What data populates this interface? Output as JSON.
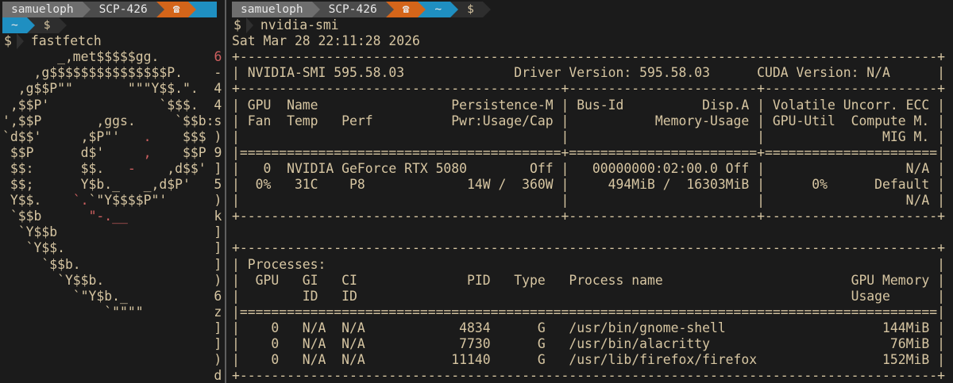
{
  "colors": {
    "background": "#1b1b1b",
    "foreground": "#d7c6a2",
    "red": "#cf6060",
    "segment_gray": "#6e6e6e",
    "segment_darkgray": "#4b4b4b",
    "segment_orange": "#d4651a",
    "segment_blue": "#1f8fc1",
    "segment_shell": "#2e2e2e",
    "prompt_fg": "#e8e8e8",
    "divider": "#5f5f5f"
  },
  "left_pane": {
    "prompt_line_1": [
      {
        "text": "samueloph",
        "bg": "segment_gray",
        "fg": "prompt_fg",
        "name": "user-segment"
      },
      {
        "text": "SCP-426",
        "bg": "segment_darkgray",
        "fg": "prompt_fg",
        "name": "host-segment"
      },
      {
        "text": "☎",
        "bg": "segment_orange",
        "fg": "prompt_fg",
        "name": "phone-icon"
      },
      {
        "text": "",
        "bg": "segment_blue",
        "fg": "prompt_fg",
        "name": "cwd-segment-clipped",
        "stub": true
      }
    ],
    "prompt_line_2": [
      {
        "text": "~",
        "bg": "segment_blue",
        "fg": "prompt_fg",
        "name": "cwd-segment"
      },
      {
        "text": "$",
        "bg": "segment_shell",
        "fg": "foreground",
        "name": "shell-segment"
      }
    ],
    "command": {
      "prompt": "$",
      "text": "fastfetch"
    },
    "fastfetch_rows": [
      [
        {
          "t": "       _,met$$$$$gg.       ",
          "c": "cream"
        },
        {
          "t": "6",
          "c": "red"
        }
      ],
      [
        {
          "t": "    ,g$$$$$$$$$$$$$$$P.    -",
          "c": "cream"
        }
      ],
      [
        {
          "t": "  ,g$$P\"\"       \"\"\"Y$$.\".  4",
          "c": "cream"
        }
      ],
      [
        {
          "t": " ,$$P'              `$$$.  4",
          "c": "cream"
        }
      ],
      [
        {
          "t": "',$$P       ,ggs.     `$$b:s",
          "c": "cream"
        }
      ],
      [
        {
          "t": "`d$$'     ,$P\"'   ",
          "c": "cream"
        },
        {
          "t": ".",
          "c": "red"
        },
        {
          "t": "    $$$ )",
          "c": "cream"
        }
      ],
      [
        {
          "t": " $$P      d$'     ",
          "c": "cream"
        },
        {
          "t": ",",
          "c": "red"
        },
        {
          "t": "    $$P 9",
          "c": "cream"
        }
      ],
      [
        {
          "t": " $$:      $$.   ",
          "c": "cream"
        },
        {
          "t": "-",
          "c": "red"
        },
        {
          "t": "    ,d$$' ]",
          "c": "cream"
        }
      ],
      [
        {
          "t": " $$;      Y$b._   _,d$P'   5",
          "c": "cream"
        }
      ],
      [
        {
          "t": " Y$$.    ",
          "c": "cream"
        },
        {
          "t": "`.",
          "c": "red"
        },
        {
          "t": "`\"Y$$$$P\"'      )",
          "c": "cream"
        }
      ],
      [
        {
          "t": " `$$b      ",
          "c": "cream"
        },
        {
          "t": "\"-.__",
          "c": "red"
        },
        {
          "t": "           k",
          "c": "cream"
        }
      ],
      [
        {
          "t": "  `Y$$b                    ]",
          "c": "cream"
        }
      ],
      [
        {
          "t": "   `Y$$.                   ]",
          "c": "cream"
        }
      ],
      [
        {
          "t": "     `$$b.                 ]",
          "c": "cream"
        }
      ],
      [
        {
          "t": "       `Y$$b.              )",
          "c": "cream"
        }
      ],
      [
        {
          "t": "         `\"Y$b._           6",
          "c": "cream"
        }
      ],
      [
        {
          "t": "             `\"\"\"\"         z",
          "c": "cream"
        }
      ],
      [
        {
          "t": "                           ]",
          "c": "cream"
        }
      ],
      [
        {
          "t": "                           ]",
          "c": "cream"
        }
      ],
      [
        {
          "t": "                           )",
          "c": "cream"
        }
      ],
      [
        {
          "t": "                           d",
          "c": "cream"
        }
      ]
    ]
  },
  "right_pane": {
    "prompt_line": [
      {
        "text": "samueloph",
        "bg": "segment_gray",
        "fg": "prompt_fg",
        "name": "user-segment"
      },
      {
        "text": "SCP-426",
        "bg": "segment_darkgray",
        "fg": "prompt_fg",
        "name": "host-segment"
      },
      {
        "text": "☎",
        "bg": "segment_orange",
        "fg": "prompt_fg",
        "name": "phone-icon"
      },
      {
        "text": "~",
        "bg": "segment_blue",
        "fg": "prompt_fg",
        "name": "cwd-segment"
      },
      {
        "text": "$",
        "bg": "segment_shell",
        "fg": "foreground",
        "name": "shell-segment"
      }
    ],
    "command": {
      "prompt": "$",
      "text": "nvidia-smi"
    },
    "date_line": "Sat Mar 28 22:11:28 2026",
    "nvidia_smi": {
      "summary": {
        "nvidia_smi_version": "595.58.03",
        "driver_version": "595.58.03",
        "cuda_version": "N/A",
        "gpus": [
          {
            "id": 0,
            "name": "NVIDIA GeForce RTX 5080",
            "persistence_m": "Off",
            "bus_id": "00000000:02:00.0",
            "disp_a": "Off",
            "volatile_uncorr_ecc": "N/A",
            "fan": "0%",
            "temp": "31C",
            "perf": "P8",
            "pwr_usage_cap": "14W /  360W",
            "memory_usage": "494MiB /  16303MiB",
            "gpu_util": "0%",
            "compute_m": "Default",
            "mig_m": "N/A"
          }
        ],
        "processes": [
          {
            "gpu": 0,
            "gi_id": "N/A",
            "ci_id": "N/A",
            "pid": 4834,
            "type": "G",
            "process_name": "/usr/bin/gnome-shell",
            "gpu_memory_usage": "144MiB"
          },
          {
            "gpu": 0,
            "gi_id": "N/A",
            "ci_id": "N/A",
            "pid": 7730,
            "type": "G",
            "process_name": "/usr/bin/alacritty",
            "gpu_memory_usage": "76MiB"
          },
          {
            "gpu": 0,
            "gi_id": "N/A",
            "ci_id": "N/A",
            "pid": 11140,
            "type": "G",
            "process_name": "/usr/lib/firefox/firefox",
            "gpu_memory_usage": "152MiB"
          }
        ]
      },
      "lines": [
        "+-----------------------------------------------------------------------------------------+",
        "| NVIDIA-SMI 595.58.03              Driver Version: 595.58.03      CUDA Version: N/A      |",
        "+-----------------------------------------+------------------------+----------------------+",
        "| GPU  Name                 Persistence-M | Bus-Id          Disp.A | Volatile Uncorr. ECC |",
        "| Fan  Temp   Perf          Pwr:Usage/Cap |           Memory-Usage | GPU-Util  Compute M. |",
        "|                                         |                        |               MIG M. |",
        "|=========================================+========================+======================|",
        "|   0  NVIDIA GeForce RTX 5080        Off |   00000000:02:00.0 Off |                  N/A |",
        "|  0%   31C    P8             14W /  360W |     494MiB /  16303MiB |      0%      Default |",
        "|                                         |                        |                  N/A |",
        "+-----------------------------------------+------------------------+----------------------+",
        "",
        "+-----------------------------------------------------------------------------------------+",
        "| Processes:                                                                              |",
        "|  GPU   GI   CI              PID   Type   Process name                        GPU Memory |",
        "|        ID   ID                                                               Usage      |",
        "|=========================================================================================|",
        "|    0   N/A  N/A            4834      G   /usr/bin/gnome-shell                    144MiB |",
        "|    0   N/A  N/A            7730      G   /usr/bin/alacritty                       76MiB |",
        "|    0   N/A  N/A           11140      G   /usr/lib/firefox/firefox                152MiB |",
        "+-----------------------------------------------------------------------------------------+"
      ]
    }
  }
}
